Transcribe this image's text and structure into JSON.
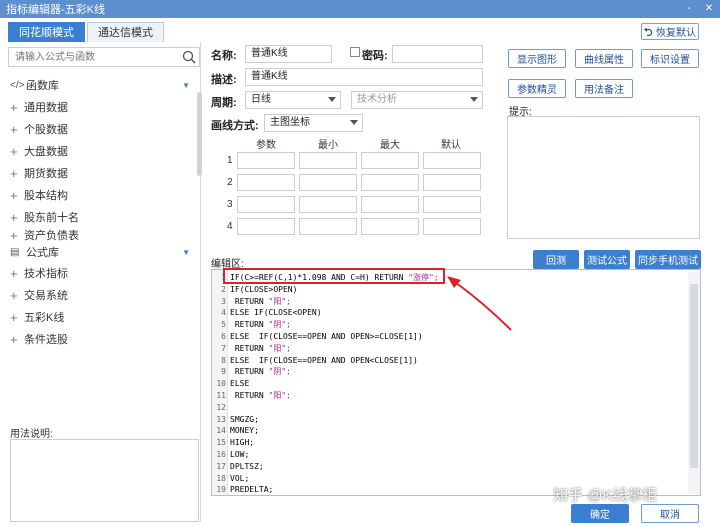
{
  "window": {
    "title": "指标编辑器-五彩K线",
    "minimize": "-",
    "close": "✕"
  },
  "tabs": [
    {
      "label": "同花顺模式",
      "active": true
    },
    {
      "label": "通达信模式",
      "active": false
    }
  ],
  "restore_default": "恢复默认",
  "search": {
    "placeholder": "请输入公式与函数"
  },
  "tree": {
    "function_lib": "函数库",
    "function_items": [
      "通用数据",
      "个股数据",
      "大盘数据",
      "期货数据",
      "股本结构",
      "股东前十名",
      "资产负债表"
    ],
    "formula_lib": "公式库",
    "formula_items": [
      "技术指标",
      "交易系统",
      "五彩K线",
      "条件选股"
    ]
  },
  "usage": {
    "label": "用法说明:"
  },
  "form": {
    "name_label": "名称:",
    "name_value": "普通K线",
    "password_label": "密码:",
    "desc_label": "描述:",
    "desc_value": "普通K线",
    "period_label": "周期:",
    "period_value": "日线",
    "category_value": "技术分析",
    "draw_label": "画线方式:",
    "draw_value": "主图坐标",
    "param_headers": [
      "参数",
      "最小",
      "最大",
      "默认"
    ],
    "param_rows": [
      "1",
      "2",
      "3",
      "4"
    ]
  },
  "buttons": {
    "show_graph": "显示图形",
    "curve_props": "曲线属性",
    "mark_settings": "标识设置",
    "param_wizard": "参数精灵",
    "usage_note": "用法备注",
    "backtest": "回测",
    "test_formula": "测试公式",
    "sync_mobile": "同步手机测试",
    "ok": "确定",
    "cancel": "取消"
  },
  "hint_label": "提示:",
  "editor": {
    "label": "编辑区:",
    "lines": [
      {
        "n": "1",
        "code": "IF(C>=REF(C,1)*1.098 AND C=H) RETURN ",
        "str": "\"涨停\";"
      },
      {
        "n": "2",
        "code": "IF(CLOSE>OPEN)",
        "str": ""
      },
      {
        "n": "3",
        "code": " RETURN ",
        "str": "\"阳\";"
      },
      {
        "n": "4",
        "code": "ELSE IF(CLOSE<OPEN)",
        "str": ""
      },
      {
        "n": "5",
        "code": " RETURN ",
        "str": "\"阴\";"
      },
      {
        "n": "6",
        "code": "ELSE  IF(CLOSE==OPEN AND OPEN>=CLOSE[1])",
        "str": ""
      },
      {
        "n": "7",
        "code": " RETURN ",
        "str": "\"阳\";"
      },
      {
        "n": "8",
        "code": "ELSE  IF(CLOSE==OPEN AND OPEN<CLOSE[1])",
        "str": ""
      },
      {
        "n": "9",
        "code": " RETURN ",
        "str": "\"阴\";"
      },
      {
        "n": "10",
        "code": "ELSE",
        "str": ""
      },
      {
        "n": "11",
        "code": " RETURN ",
        "str": "\"阳\";"
      },
      {
        "n": "12",
        "code": "",
        "str": ""
      },
      {
        "n": "13",
        "code": "SMGZG;",
        "str": ""
      },
      {
        "n": "14",
        "code": "MONEY;",
        "str": ""
      },
      {
        "n": "15",
        "code": "HIGH;",
        "str": ""
      },
      {
        "n": "16",
        "code": "LOW;",
        "str": ""
      },
      {
        "n": "17",
        "code": "DPLTSZ;",
        "str": ""
      },
      {
        "n": "18",
        "code": "VOL;",
        "str": ""
      },
      {
        "n": "19",
        "code": "PREDELTA;",
        "str": ""
      }
    ]
  },
  "watermark": "知乎 @K线掌柜",
  "colors": {
    "accent": "#3c7fd0",
    "title_bar": "#5b8fd0",
    "highlight": "#d8232a",
    "string": "#b0249a"
  }
}
